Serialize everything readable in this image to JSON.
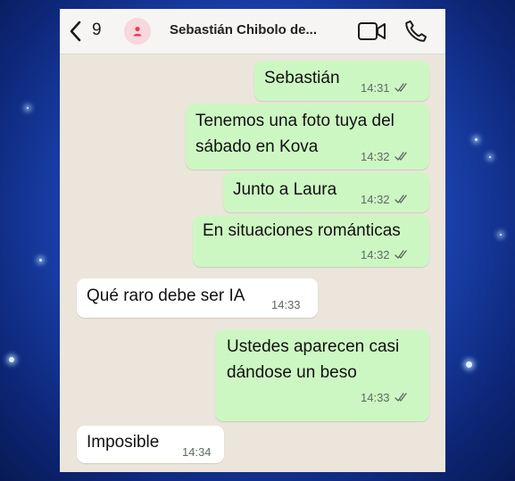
{
  "header": {
    "unread_count": "9",
    "contact_name": "Sebastián Chibolo de..."
  },
  "messages": [
    {
      "direction": "out",
      "lines": [
        "Sebastián"
      ],
      "time": "14:31"
    },
    {
      "direction": "out",
      "lines": [
        "Tenemos una foto tuya del",
        "sábado en Kova"
      ],
      "time": "14:32"
    },
    {
      "direction": "out",
      "lines": [
        "Junto a Laura"
      ],
      "time": "14:32"
    },
    {
      "direction": "out",
      "lines": [
        "En situaciones románticas"
      ],
      "time": "14:32"
    },
    {
      "direction": "in",
      "lines": [
        "Qué raro debe ser IA"
      ],
      "time": "14:33"
    },
    {
      "direction": "out",
      "lines": [
        "Ustedes aparecen casi",
        "dándose un beso"
      ],
      "time": "14:33"
    },
    {
      "direction": "in",
      "lines": [
        "Imposible"
      ],
      "time": "14:34"
    }
  ],
  "colors": {
    "outgoing_bubble": "#cdf7c2",
    "incoming_bubble": "#ffffff",
    "chat_background": "#ebe5dc"
  },
  "icons": [
    "chevron-left-icon",
    "person-icon",
    "video-call-icon",
    "phone-icon",
    "double-check-icon"
  ]
}
